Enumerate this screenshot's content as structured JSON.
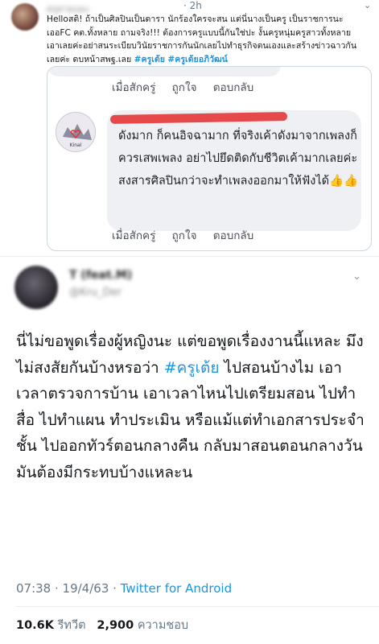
{
  "top_tweet": {
    "author_blurred": "ครูสายแดง",
    "time": "· 2h",
    "text_before_tags": "Helloสติ! ถ้าเป็นศิลปินเป็นดารา นักร้องใครจะสน แต่นี่นางเป็นครู เป็นราชการนะ เออFC คต.ทั้งหลาย ถามจริง!!! ต้องการครูแบบนี้กันใช่ปะ งั้นครูหนุ่มครูสาวทั้งหลาย เอาเลยค่ะอย่าสนระเบียบวินัยราชการกันนักเลยไปทำธุรกิจตนเองและสร้างข่าวฉาวกันเลยค่ะ ดบหน้าสพฐ.เลย",
    "tag1": "#ครูเต้ย",
    "tag2": "#ครูเต้ยอภิวัฒน์"
  },
  "embed": {
    "actions": {
      "time": "เมื่อสักครู่",
      "like": "ถูกใจ",
      "reply": "ตอบกลับ"
    },
    "commenter_avatar_text": "Kinal",
    "comment_text": "ดังมาก ก็คนอิจฉามาก ที่จริงเค้าดังมาจากเพลงก็ควรเสพเพลง อย่าไปยึดติดกับชีวิตเค้ามากเลยค่ะ สงสารศิลปินกว่าจะทำเพลงออกมาให้ฟังได้👍👍",
    "actions2": {
      "time": "เมื่อสักครู่",
      "like": "ถูกใจ",
      "reply": "ตอบกลับ"
    }
  },
  "main_tweet": {
    "author_blurred": "T (feat.M)",
    "handle_blurred": "@Kru_Der",
    "text_part1": "นี่ไม่ขอพูดเรื่องผู้หญิงนะ แต่ขอพูดเรื่องงานนี้แหละ มึงไม่สงสัยกันบ้างหรอว่า ",
    "hashtag": "#ครูเต้ย",
    "text_part2": " ไปสอนบ้างไม เอาเวลาตรวจการบ้าน เอาเวลาไหนไปเตรียมสอน ไปทำสื่อ ไปทำแผน ทำประเมิน หรือแม้แต่ทำเอกสารประจำชั้น ไปออกทัวร์ตอนกลางคืน กลับมาสอนตอนกลางวัน มันต้องมีกระทบบ้างแหละน",
    "time": "07:38 · 19/4/63 · ",
    "source": "Twitter for Android",
    "retweets_count": "10.6K",
    "retweets_label": "รีทวีต",
    "likes_count": "2,900",
    "likes_label": "ความชอบ"
  },
  "colors": {
    "link": "#1b95e0",
    "muted": "#657786",
    "redact": "#e43b3b"
  }
}
